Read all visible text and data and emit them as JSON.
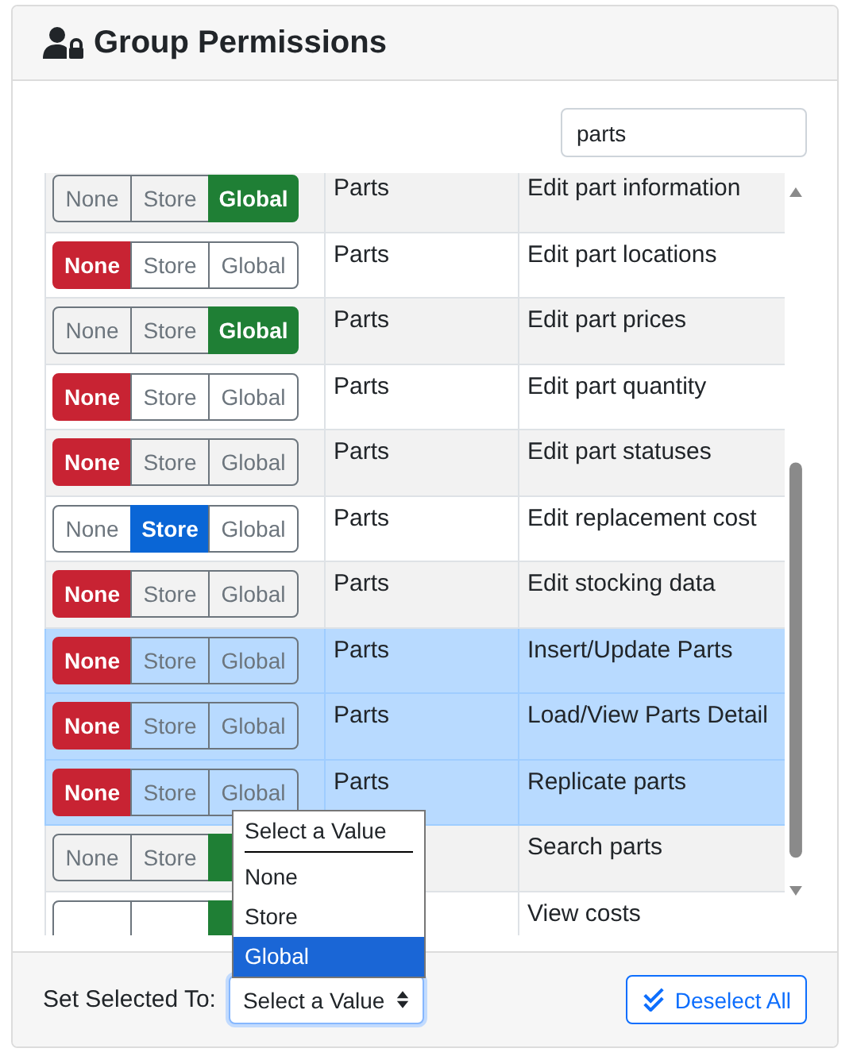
{
  "header": {
    "title": "Group Permissions"
  },
  "search": {
    "value": "parts"
  },
  "rows": [
    {
      "options": [
        {
          "kind": "none",
          "label": "None",
          "selected": false
        },
        {
          "kind": "store",
          "label": "Store",
          "selected": false
        },
        {
          "kind": "global",
          "label": "Global",
          "selected": true
        }
      ],
      "category": "Parts",
      "description": "Edit part information",
      "selected": false
    },
    {
      "options": [
        {
          "kind": "none",
          "label": "None",
          "selected": true
        },
        {
          "kind": "store",
          "label": "Store",
          "selected": false
        },
        {
          "kind": "global",
          "label": "Global",
          "selected": false
        }
      ],
      "category": "Parts",
      "description": "Edit part locations",
      "selected": false
    },
    {
      "options": [
        {
          "kind": "none",
          "label": "None",
          "selected": false
        },
        {
          "kind": "store",
          "label": "Store",
          "selected": false
        },
        {
          "kind": "global",
          "label": "Global",
          "selected": true
        }
      ],
      "category": "Parts",
      "description": "Edit part prices",
      "selected": false
    },
    {
      "options": [
        {
          "kind": "none",
          "label": "None",
          "selected": true
        },
        {
          "kind": "store",
          "label": "Store",
          "selected": false
        },
        {
          "kind": "global",
          "label": "Global",
          "selected": false
        }
      ],
      "category": "Parts",
      "description": "Edit part quantity",
      "selected": false
    },
    {
      "options": [
        {
          "kind": "none",
          "label": "None",
          "selected": true
        },
        {
          "kind": "store",
          "label": "Store",
          "selected": false
        },
        {
          "kind": "global",
          "label": "Global",
          "selected": false
        }
      ],
      "category": "Parts",
      "description": "Edit part statuses",
      "selected": false
    },
    {
      "options": [
        {
          "kind": "none",
          "label": "None",
          "selected": false
        },
        {
          "kind": "store",
          "label": "Store",
          "selected": true
        },
        {
          "kind": "global",
          "label": "Global",
          "selected": false
        }
      ],
      "category": "Parts",
      "description": "Edit replacement cost",
      "selected": false
    },
    {
      "options": [
        {
          "kind": "none",
          "label": "None",
          "selected": true
        },
        {
          "kind": "store",
          "label": "Store",
          "selected": false
        },
        {
          "kind": "global",
          "label": "Global",
          "selected": false
        }
      ],
      "category": "Parts",
      "description": "Edit stocking data",
      "selected": false
    },
    {
      "options": [
        {
          "kind": "none",
          "label": "None",
          "selected": true
        },
        {
          "kind": "store",
          "label": "Store",
          "selected": false
        },
        {
          "kind": "global",
          "label": "Global",
          "selected": false
        }
      ],
      "category": "Parts",
      "description": "Insert/Update Parts",
      "selected": true
    },
    {
      "options": [
        {
          "kind": "none",
          "label": "None",
          "selected": true
        },
        {
          "kind": "store",
          "label": "Store",
          "selected": false
        },
        {
          "kind": "global",
          "label": "Global",
          "selected": false
        }
      ],
      "category": "Parts",
      "description": "Load/View Parts Detail",
      "selected": true
    },
    {
      "options": [
        {
          "kind": "none",
          "label": "None",
          "selected": true
        },
        {
          "kind": "store",
          "label": "Store",
          "selected": false
        },
        {
          "kind": "global",
          "label": "Global",
          "selected": false
        }
      ],
      "category": "Parts",
      "description": "Replicate parts",
      "selected": true
    },
    {
      "options": [
        {
          "kind": "none",
          "label": "None",
          "selected": false
        },
        {
          "kind": "store",
          "label": "Store",
          "selected": false
        },
        {
          "kind": "global",
          "selected": true
        }
      ],
      "description": "Search parts",
      "selected": false
    },
    {
      "options": [
        {
          "kind": "none",
          "selected": false
        },
        {
          "kind": "store",
          "selected": false
        },
        {
          "kind": "global",
          "selected": true
        }
      ],
      "description": "View costs",
      "selected": false
    }
  ],
  "select_menu": {
    "options": [
      {
        "label": "Select a Value",
        "selected": false
      },
      {
        "label": "None",
        "selected": false
      },
      {
        "label": "Store",
        "selected": false
      },
      {
        "label": "Global",
        "selected": true
      }
    ]
  },
  "footer": {
    "label": "Set Selected To:",
    "select_value": "Select a Value",
    "button": "Deselect All"
  }
}
